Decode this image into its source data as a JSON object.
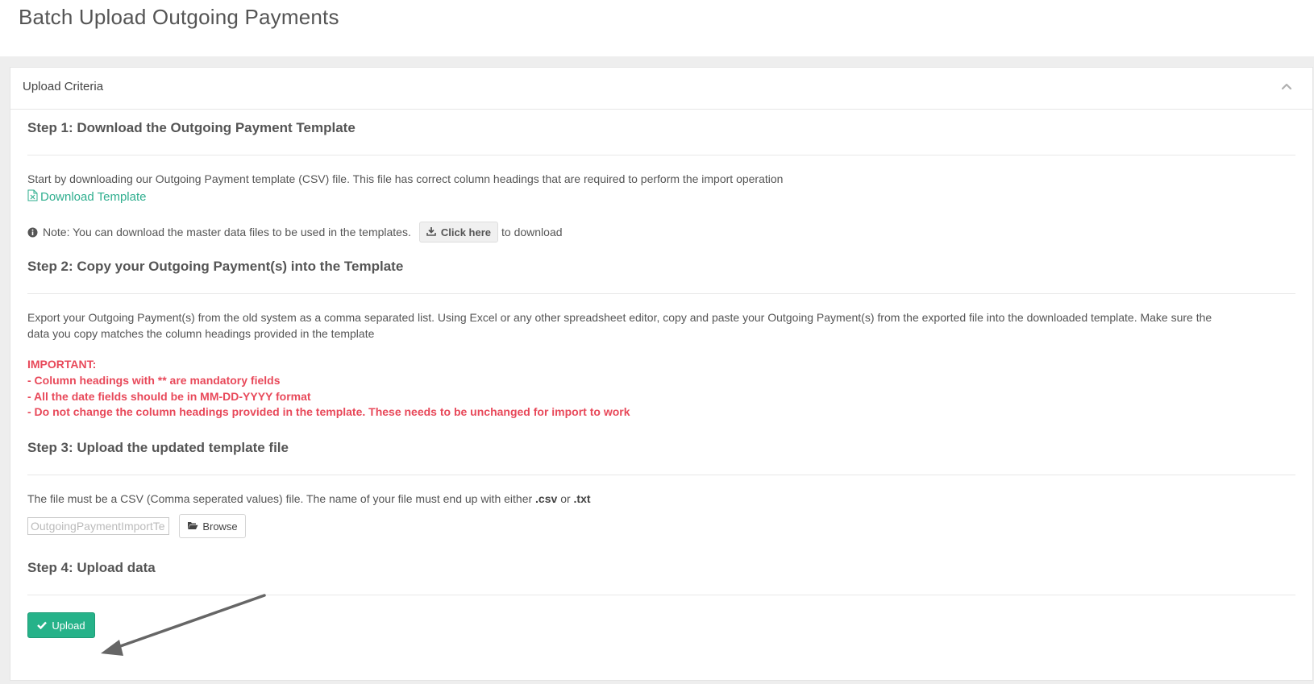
{
  "page": {
    "title": "Batch Upload Outgoing Payments"
  },
  "panel": {
    "title": "Upload Criteria"
  },
  "step1": {
    "title": "Step 1: Download the Outgoing Payment Template",
    "description": "Start by downloading our Outgoing Payment template (CSV) file. This file has correct column headings that are required to perform the import operation",
    "download_link": "Download Template",
    "note_text": "Note: You can download the master data files to be used in the templates.",
    "click_here_label": "Click here",
    "note_suffix": "to download"
  },
  "step2": {
    "title": "Step 2: Copy your Outgoing Payment(s) into the Template",
    "description_line1": "Export your Outgoing Payment(s) from the old system as a comma separated list. Using Excel or any other spreadsheet editor, copy and paste your Outgoing Payment(s) from the exported file into the downloaded template. Make sure the",
    "description_line2": "data you copy matches the column headings provided in the template",
    "important_heading": "IMPORTANT:",
    "important_items": [
      "- Column headings with ** are mandatory fields",
      "- All the date fields should be in MM-DD-YYYY format",
      "- Do not change the column headings provided in the template. These needs to be unchanged for import to work"
    ]
  },
  "step3": {
    "title": "Step 3: Upload the updated template file",
    "description_prefix": "The file must be a CSV (Comma seperated values) file. The name of your file must end up with either",
    "ext_csv": ".csv",
    "or_text": "or",
    "ext_txt": ".txt",
    "file_value": "OutgoingPaymentImportTe",
    "browse_label": "Browse"
  },
  "step4": {
    "title": "Step 4: Upload data",
    "upload_label": "Upload"
  },
  "colors": {
    "accent": "#26b289",
    "link": "#2eae8e",
    "important": "#e8495a"
  },
  "icons": {
    "collapse": "chevron-up-icon",
    "download_template": "file-excel-icon",
    "note": "info-circle-icon",
    "click_here": "download-icon",
    "browse": "folder-open-icon",
    "upload": "check-icon"
  }
}
